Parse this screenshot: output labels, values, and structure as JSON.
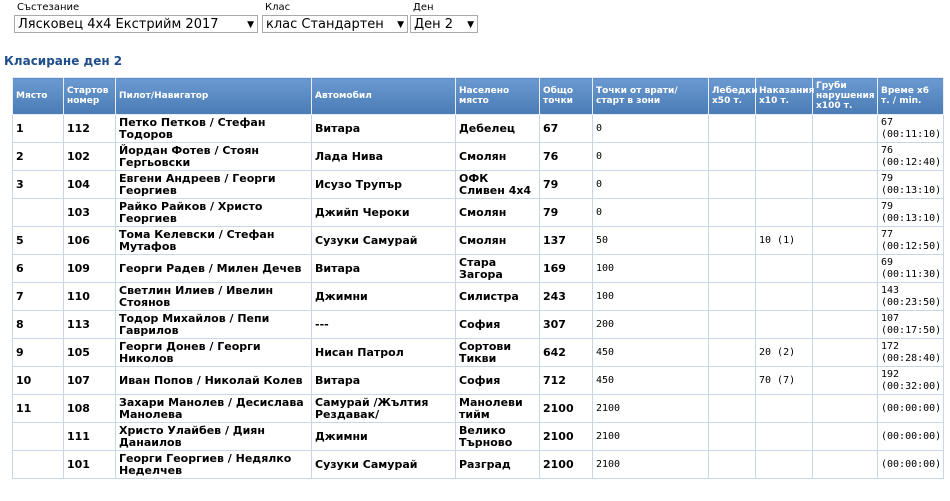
{
  "filters": {
    "competition": {
      "label": "Състезание",
      "value": "Лясковец 4x4 Екстрийм 2017"
    },
    "class": {
      "label": "Клас",
      "value": "клас Стандартен"
    },
    "day": {
      "label": "Ден",
      "value": "Ден 2"
    }
  },
  "title": "Класиране ден 2",
  "columns": [
    "Място",
    "Стартов номер",
    "Пилот/Навигатор",
    "Автомобил",
    "Населено място",
    "Общо точки",
    "Точки от врати/старт в зони",
    "Лебедки x50 т.",
    "Наказания x10 т.",
    "Груби нарушения x100 т.",
    "Време x6 т. / min."
  ],
  "rows": [
    {
      "place": "1",
      "num": "112",
      "crew": "Петко Петков / Стефан Тодоров",
      "car": "Витара",
      "town": "Дебелец",
      "total": "67",
      "gates": "0",
      "winch": "",
      "pen": "",
      "gross": "",
      "time1": "67",
      "time2": "(00:11:10)"
    },
    {
      "place": "2",
      "num": "102",
      "crew": "Йордан Фотев / Стоян Гергьовски",
      "car": "Лада Нива",
      "town": "Смолян",
      "total": "76",
      "gates": "0",
      "winch": "",
      "pen": "",
      "gross": "",
      "time1": "76",
      "time2": "(00:12:40)"
    },
    {
      "place": "3",
      "num": "104",
      "crew": "Евгени Андреев / Георги Георгиев",
      "car": "Исузо Трупър",
      "town": "ОФК Сливен 4x4",
      "total": "79",
      "gates": "0",
      "winch": "",
      "pen": "",
      "gross": "",
      "time1": "79",
      "time2": "(00:13:10)"
    },
    {
      "place": "",
      "num": "103",
      "crew": "Райко Райков / Христо Георгиев",
      "car": "Джийп Чероки",
      "town": "Смолян",
      "total": "79",
      "gates": "0",
      "winch": "",
      "pen": "",
      "gross": "",
      "time1": "79",
      "time2": "(00:13:10)"
    },
    {
      "place": "5",
      "num": "106",
      "crew": "Тома Келевски / Стефан Мутафов",
      "car": "Сузуки Самурай",
      "town": "Смолян",
      "total": "137",
      "gates": "50",
      "winch": "",
      "pen": "10 (1)",
      "gross": "",
      "time1": "77",
      "time2": "(00:12:50)"
    },
    {
      "place": "6",
      "num": "109",
      "crew": "Георги Радев / Милен Дечев",
      "car": "Витара",
      "town": "Стара Загора",
      "total": "169",
      "gates": "100",
      "winch": "",
      "pen": "",
      "gross": "",
      "time1": "69",
      "time2": "(00:11:30)"
    },
    {
      "place": "7",
      "num": "110",
      "crew": "Светлин Илиев / Ивелин Стоянов",
      "car": "Джимни",
      "town": "Силистра",
      "total": "243",
      "gates": "100",
      "winch": "",
      "pen": "",
      "gross": "",
      "time1": "143",
      "time2": "(00:23:50)"
    },
    {
      "place": "8",
      "num": "113",
      "crew": "Тодор Михайлов / Пепи Гаврилов",
      "car": "---",
      "town": "София",
      "total": "307",
      "gates": "200",
      "winch": "",
      "pen": "",
      "gross": "",
      "time1": "107",
      "time2": "(00:17:50)"
    },
    {
      "place": "9",
      "num": "105",
      "crew": "Георги Донев / Георги Николов",
      "car": "Нисан Патрол",
      "town": "Сортови Тикви",
      "total": "642",
      "gates": "450",
      "winch": "",
      "pen": "20 (2)",
      "gross": "",
      "time1": "172",
      "time2": "(00:28:40)"
    },
    {
      "place": "10",
      "num": "107",
      "crew": "Иван Попов / Николай Колев",
      "car": "Витара",
      "town": "София",
      "total": "712",
      "gates": "450",
      "winch": "",
      "pen": "70 (7)",
      "gross": "",
      "time1": "192",
      "time2": "(00:32:00)"
    },
    {
      "place": "11",
      "num": "108",
      "crew": "Захари Манолев / Десислава Манолева",
      "car": "Самурай /Жълтия Рездавак/",
      "town": "Манолеви тийм",
      "total": "2100",
      "gates": "2100",
      "winch": "",
      "pen": "",
      "gross": "",
      "time1": "",
      "time2": "(00:00:00)"
    },
    {
      "place": "",
      "num": "111",
      "crew": "Христо Улайбев / Диян Данаилов",
      "car": "Джимни",
      "town": "Велико Търново",
      "total": "2100",
      "gates": "2100",
      "winch": "",
      "pen": "",
      "gross": "",
      "time1": "",
      "time2": "(00:00:00)"
    },
    {
      "place": "",
      "num": "101",
      "crew": "Георги Георгиев / Недялко Неделчев",
      "car": "Сузуки Самурай",
      "town": "Разград",
      "total": "2100",
      "gates": "2100",
      "winch": "",
      "pen": "",
      "gross": "",
      "time1": "",
      "time2": "(00:00:00)"
    }
  ]
}
